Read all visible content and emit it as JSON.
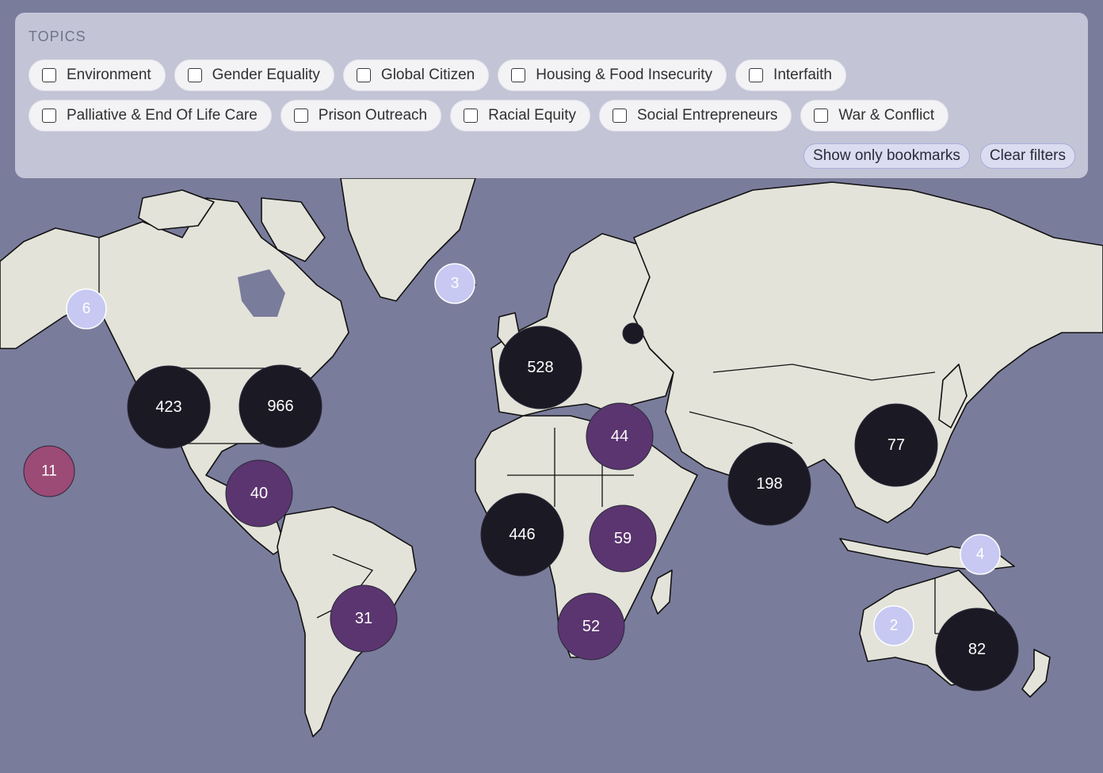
{
  "panel": {
    "title": "TOPICS",
    "topics_row1": [
      "Environment",
      "Gender Equality",
      "Global Citizen",
      "Housing & Food Insecurity",
      "Interfaith"
    ],
    "topics_row2": [
      "Palliative & End Of Life Care",
      "Prison Outreach",
      "Racial Equity",
      "Social Entrepreneurs",
      "War & Conflict"
    ],
    "show_bookmarks_label": "Show only bookmarks",
    "clear_filters_label": "Clear filters"
  },
  "map": {
    "ocean_color": "#7a7c9b",
    "land_color": "#e3e3da",
    "clusters": [
      {
        "name": "alaska",
        "label": "6",
        "color": "#c7c9f3"
      },
      {
        "name": "iceland",
        "label": "3",
        "color": "#c7c9f3"
      },
      {
        "name": "western-us",
        "label": "423",
        "color": "#1b1a24"
      },
      {
        "name": "eastern-us",
        "label": "966",
        "color": "#1b1a24"
      },
      {
        "name": "europe",
        "label": "528",
        "color": "#1b1a24"
      },
      {
        "name": "russia",
        "label": "",
        "color": "#1b1a24"
      },
      {
        "name": "hawaii",
        "label": "11",
        "color": "#9c4a76"
      },
      {
        "name": "central-america",
        "label": "40",
        "color": "#5b356f"
      },
      {
        "name": "middle-east",
        "label": "44",
        "color": "#5b356f"
      },
      {
        "name": "east-asia",
        "label": "77",
        "color": "#1b1a24"
      },
      {
        "name": "south-asia",
        "label": "198",
        "color": "#1b1a24"
      },
      {
        "name": "west-africa",
        "label": "446",
        "color": "#1b1a24"
      },
      {
        "name": "east-africa",
        "label": "59",
        "color": "#5b356f"
      },
      {
        "name": "southern-africa",
        "label": "52",
        "color": "#5b356f"
      },
      {
        "name": "south-america",
        "label": "31",
        "color": "#5b356f"
      },
      {
        "name": "papua",
        "label": "4",
        "color": "#c7c9f3"
      },
      {
        "name": "western-australia",
        "label": "2",
        "color": "#c7c9f3"
      },
      {
        "name": "eastern-australia",
        "label": "82",
        "color": "#1b1a24"
      }
    ]
  }
}
